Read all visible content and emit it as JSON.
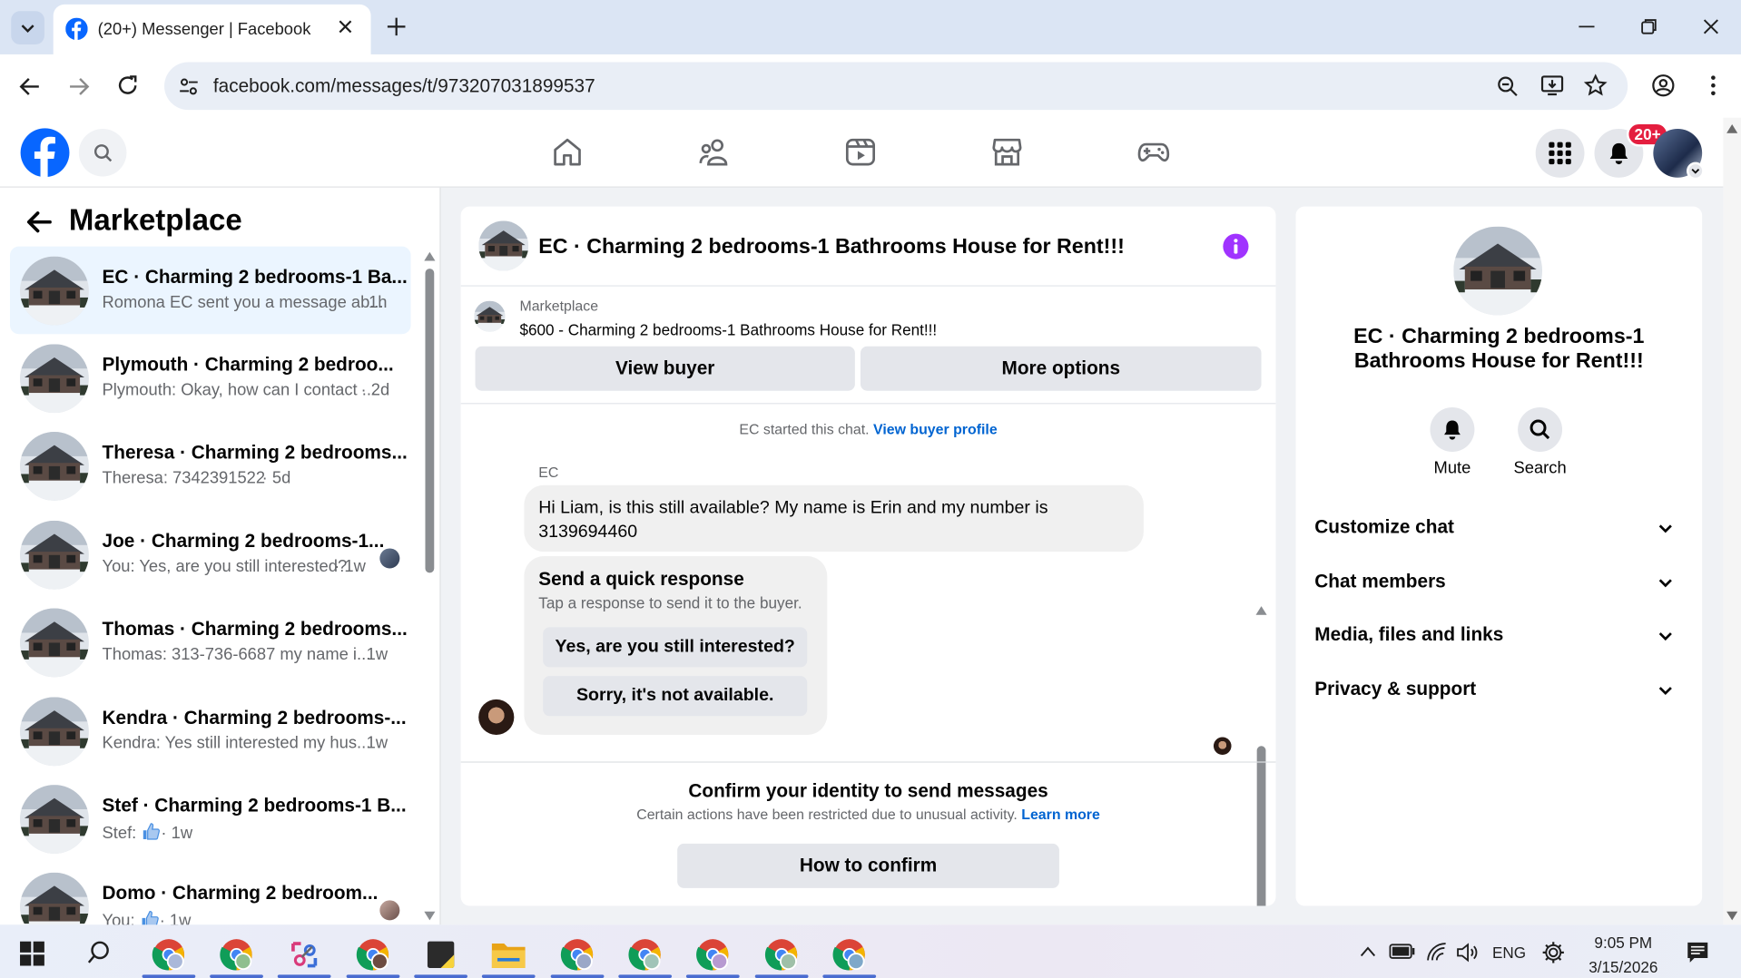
{
  "browser": {
    "tab_title": "(20+) Messenger | Facebook",
    "url": "facebook.com/messages/t/973207031899537"
  },
  "fb": {
    "notification_badge": "20+"
  },
  "left": {
    "title": "Marketplace",
    "conversations": [
      {
        "name": "EC · Charming 2 bedrooms-1 Ba...",
        "preview": "Romona EC sent you a message ab...",
        "time": "1h"
      },
      {
        "name": "Plymouth · Charming 2 bedroo...",
        "preview": "Plymouth: Okay, how can I contact ...",
        "time": "· 2d"
      },
      {
        "name": "Theresa · Charming 2 bedrooms...",
        "preview": "Theresa: 7342391522",
        "time": "· 5d"
      },
      {
        "name": "Joe · Charming 2 bedrooms-1...",
        "preview": "You: Yes, are you still interested?",
        "time": "· 1w"
      },
      {
        "name": "Thomas · Charming 2 bedrooms...",
        "preview": "Thomas: 313-736-6687 my name i...",
        "time": "1w"
      },
      {
        "name": "Kendra · Charming 2 bedrooms-...",
        "preview": "Kendra: Yes still interested my hus...",
        "time": "1w"
      },
      {
        "name": "Stef · Charming 2 bedrooms-1 B...",
        "preview": "Stef:",
        "time": "· 1w"
      },
      {
        "name": "Domo · Charming 2 bedroom...",
        "preview": "You:",
        "time": "· 1w"
      }
    ]
  },
  "chat": {
    "title": "EC · Charming 2 bedrooms-1 Bathrooms House for Rent!!!",
    "listing_source": "Marketplace",
    "listing_price": "$600 - Charming 2 bedrooms-1 Bathrooms House for Rent!!!",
    "view_buyer": "View buyer",
    "more_options": "More options",
    "started_text": "EC started this chat.",
    "view_buyer_profile": "View buyer profile",
    "sender": "EC",
    "message": "Hi Liam, is this still available? My name is Erin and my number is 3139694460",
    "quick_title": "Send a quick response",
    "quick_sub": "Tap a response to send it to the buyer.",
    "quick_1": "Yes, are you still interested?",
    "quick_2": "Sorry, it's not available.",
    "confirm_title": "Confirm your identity to send messages",
    "confirm_sub": "Certain actions have been restricted due to unusual activity.",
    "learn_more": "Learn more",
    "confirm_btn": "How to confirm"
  },
  "right": {
    "title": "EC · Charming 2 bedrooms-1 Bathrooms House for Rent!!!",
    "mute": "Mute",
    "search": "Search",
    "sections": [
      "Customize chat",
      "Chat members",
      "Media, files and links",
      "Privacy & support"
    ]
  },
  "taskbar": {
    "lang": "ENG",
    "time": "9:05 PM",
    "date": "3/15/2026"
  },
  "colors": {
    "fb_blue": "#0866ff",
    "link_blue": "#0064d1",
    "info_purple": "#a033ff",
    "badge_red": "#e41e3f"
  }
}
